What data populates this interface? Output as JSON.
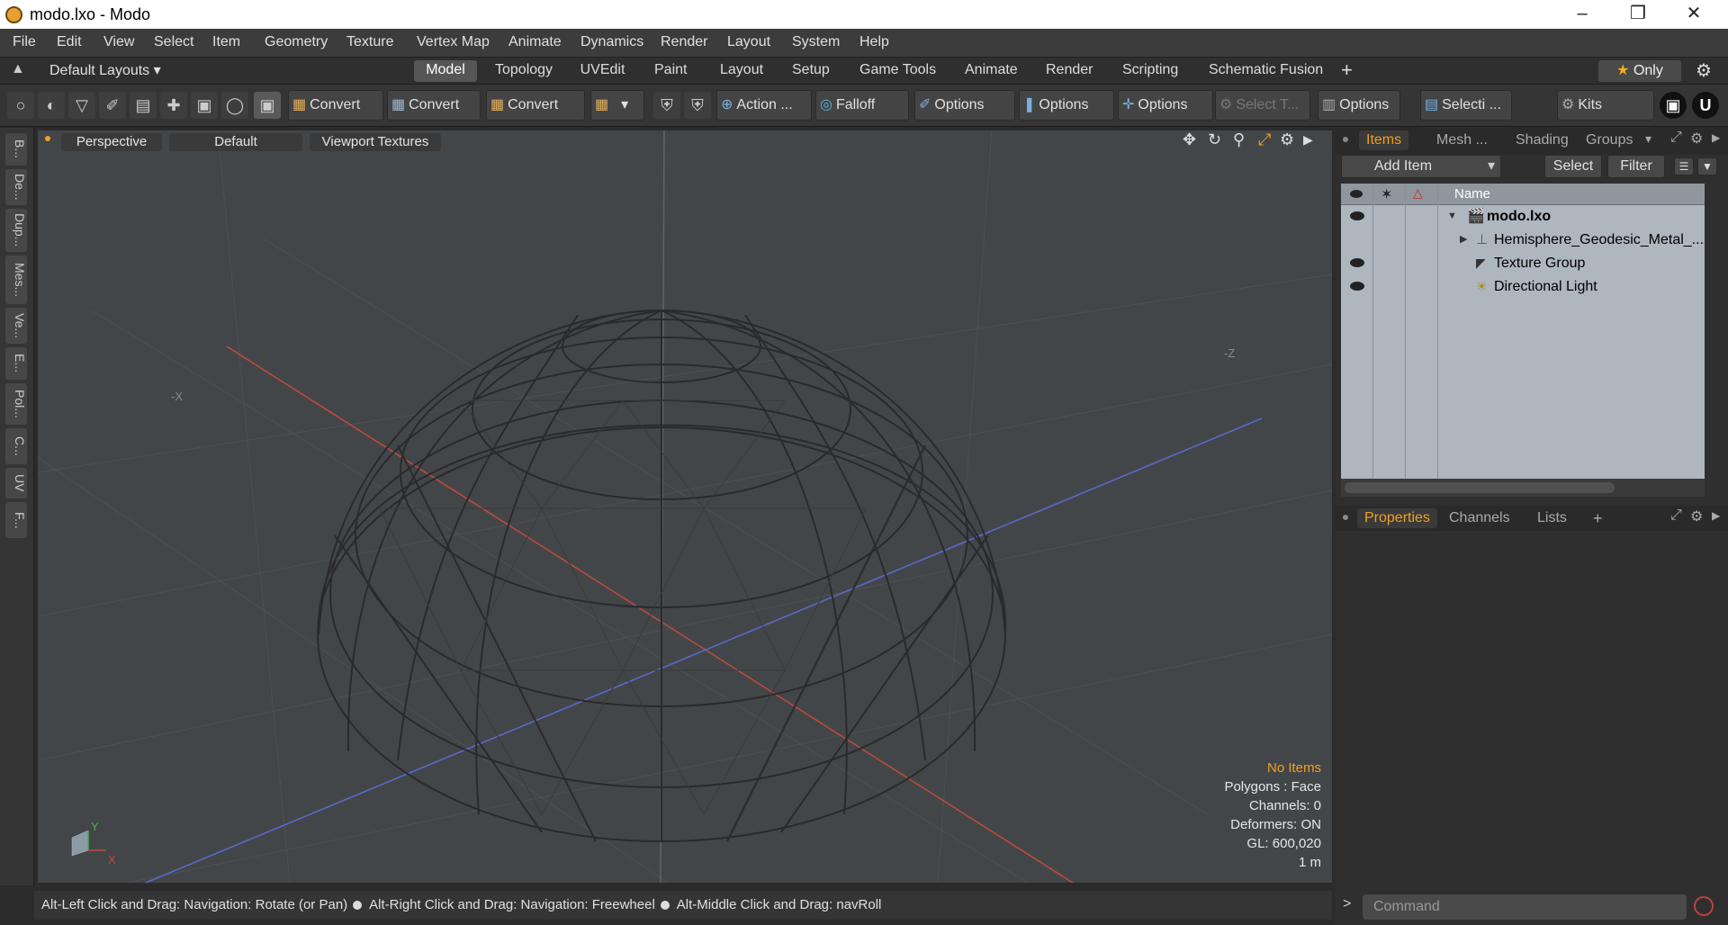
{
  "window": {
    "title": "modo.lxo - Modo",
    "controls": [
      "–",
      "❒",
      "✕"
    ]
  },
  "menubar": [
    "File",
    "Edit",
    "View",
    "Select",
    "Item",
    "Geometry",
    "Texture",
    "Vertex Map",
    "Animate",
    "Dynamics",
    "Render",
    "Layout",
    "System",
    "Help"
  ],
  "layout_bar": {
    "layouts_label": "Default Layouts",
    "tabs": [
      "Model",
      "Topology",
      "UVEdit",
      "Paint",
      "Layout",
      "Setup",
      "Game Tools",
      "Animate",
      "Render",
      "Scripting",
      "Schematic Fusion"
    ],
    "active_tab": "Model",
    "add_label": "+",
    "only_label": "Only"
  },
  "toolbar": {
    "convert1": "Convert",
    "convert2": "Convert",
    "convert3": "Convert",
    "action": "Action",
    "action_more": "...",
    "falloff": "Falloff",
    "options1": "Options",
    "options2": "Options",
    "options3": "Options",
    "select_t": "Select T...",
    "options4": "Options",
    "selecti": "Selecti ...",
    "kits": "Kits"
  },
  "left_tabs": [
    "B...",
    "De...",
    "Dup...",
    "Mes...",
    "Ve...",
    "E...",
    "Pol...",
    "C...",
    "UV",
    "F..."
  ],
  "viewport": {
    "perspective": "Perspective",
    "default": "Default",
    "textures": "Viewport Textures",
    "axis_neg_x": "-X",
    "axis_neg_z": "-Z",
    "gizmo_y": "Y",
    "gizmo_x": "X",
    "stats": {
      "no_items": "No Items",
      "polygons": "Polygons : Face",
      "channels": "Channels: 0",
      "deformers": "Deformers: ON",
      "gl": "GL: 600,020",
      "scale": "1 m"
    },
    "colors": {
      "bg": "#434649",
      "x_axis": "#c04a3c",
      "z_axis": "#5a6ad0",
      "accent": "#f0a020"
    }
  },
  "statusbar": {
    "hint1": "Alt-Left Click and Drag: Navigation: Rotate (or Pan)",
    "hint2": "Alt-Right Click and Drag: Navigation: Freewheel",
    "hint3": "Alt-Middle Click and Drag: navRoll"
  },
  "items_panel": {
    "tabs": [
      "Items",
      "Mesh ...",
      "Shading",
      "Groups"
    ],
    "active_tab": "Items",
    "add_item": "Add Item",
    "select": "Select",
    "filter": "Filter",
    "name_header": "Name",
    "rows": [
      {
        "name": "modo.lxo",
        "visible": true
      },
      {
        "name": "Hemisphere_Geodesic_Metal_...",
        "visible": false
      },
      {
        "name": "Texture Group",
        "visible": true
      },
      {
        "name": "Directional Light",
        "visible": true
      }
    ]
  },
  "properties_panel": {
    "tabs": [
      "Properties",
      "Channels",
      "Lists"
    ],
    "active_tab": "Properties",
    "add_label": "+"
  },
  "command": {
    "placeholder": "Command",
    "prompt": ">"
  }
}
